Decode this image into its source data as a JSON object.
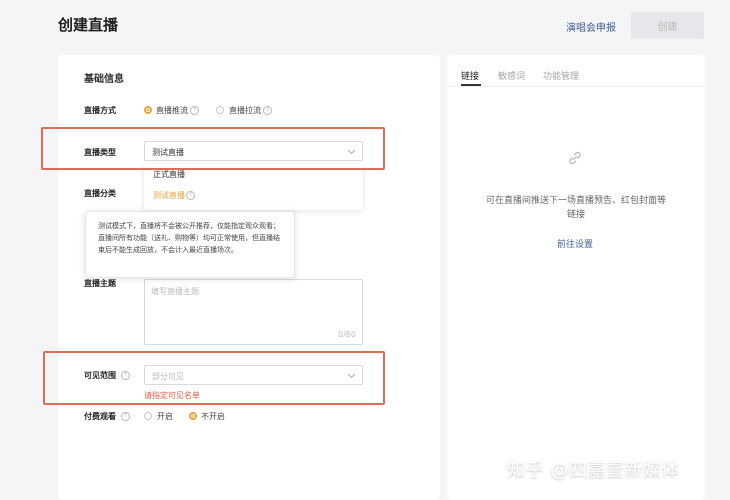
{
  "page": {
    "title": "创建直播",
    "concert_apply": "演唱会申报",
    "create_button": "创建"
  },
  "form": {
    "section_title": "基础信息",
    "live_mode": {
      "label": "直播方式",
      "options": [
        {
          "label": "直播推流",
          "selected": true
        },
        {
          "label": "直播拉流",
          "selected": false
        }
      ]
    },
    "live_type": {
      "label": "直播类型",
      "value": "测试直播",
      "dropdown_options": [
        "正式直播",
        "测试直播"
      ],
      "tooltip": "测试模式下，直播将不会被公开推荐，仅能指定观众观看；直播间所有功能（送礼、购物等）均可正常使用，但直播结束后不能生成回放，不会计入最近直播场次。"
    },
    "category": {
      "label": "直播分类"
    },
    "topic": {
      "label": "直播主题",
      "placeholder": "填写直播主题",
      "counter": "0/60"
    },
    "visibility": {
      "label": "可见范围",
      "value": "部分可见",
      "error": "请指定可见名单"
    },
    "paid": {
      "label": "付费观看",
      "options": [
        {
          "label": "开启",
          "selected": false
        },
        {
          "label": "不开启",
          "selected": true
        }
      ]
    }
  },
  "side_panel": {
    "tabs": [
      "链接",
      "敏感词",
      "功能管理"
    ],
    "active_tab": "链接",
    "empty_text": "可在直播间推送下一场直播预告、红包封面等链接",
    "goto_settings": "前往设置"
  },
  "watermark": "知乎 @四嘉壹新媒体",
  "colors": {
    "accent_orange": "#e9a33b",
    "highlight_red": "#dd6d56",
    "link_blue": "#3f5f92",
    "error_red": "#e55a42"
  },
  "icons": [
    "help-icon",
    "chevron-down-icon",
    "link-icon"
  ]
}
